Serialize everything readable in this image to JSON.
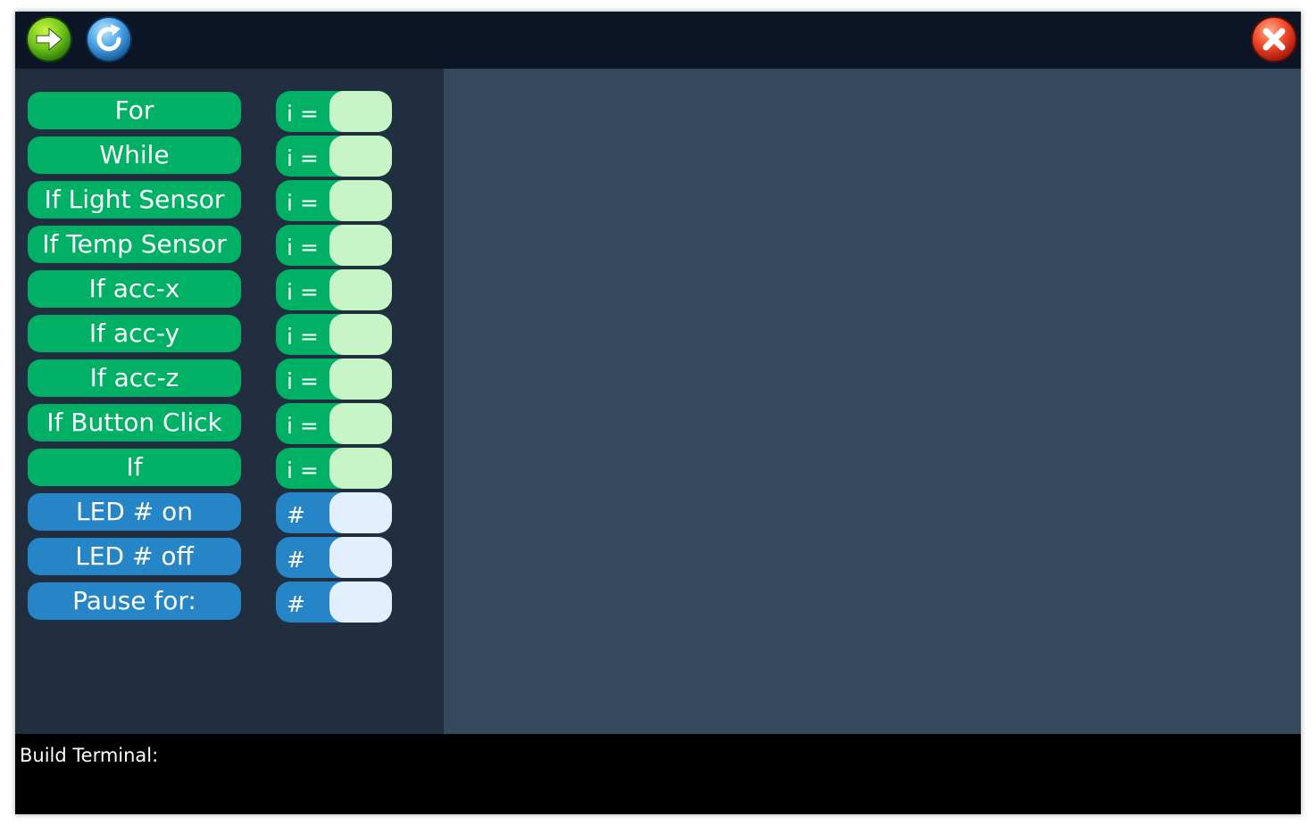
{
  "toolbar": {
    "run_icon": "arrow-right-icon",
    "refresh_icon": "refresh-icon",
    "close_icon": "close-icon"
  },
  "palette": {
    "blocks": [
      {
        "label": "For",
        "color": "green",
        "param_label": "i =",
        "param_value": ""
      },
      {
        "label": "While",
        "color": "green",
        "param_label": "i =",
        "param_value": ""
      },
      {
        "label": "If Light Sensor",
        "color": "green",
        "param_label": "i =",
        "param_value": ""
      },
      {
        "label": "If Temp Sensor",
        "color": "green",
        "param_label": "i =",
        "param_value": ""
      },
      {
        "label": "If acc-x",
        "color": "green",
        "param_label": "i =",
        "param_value": ""
      },
      {
        "label": "If acc-y",
        "color": "green",
        "param_label": "i =",
        "param_value": ""
      },
      {
        "label": "If acc-z",
        "color": "green",
        "param_label": "i =",
        "param_value": ""
      },
      {
        "label": "If Button Click",
        "color": "green",
        "param_label": "i =",
        "param_value": ""
      },
      {
        "label": "If",
        "color": "green",
        "param_label": "i =",
        "param_value": ""
      },
      {
        "label": "LED # on",
        "color": "blue",
        "param_label": "#",
        "param_value": ""
      },
      {
        "label": "LED # off",
        "color": "blue",
        "param_label": "#",
        "param_value": ""
      },
      {
        "label": "Pause for:",
        "color": "blue",
        "param_label": "#",
        "param_value": ""
      }
    ]
  },
  "terminal": {
    "label": "Build Terminal:"
  },
  "colors": {
    "control_block": "#00b064",
    "action_block": "#2585c6",
    "control_input": "#c8f5c8",
    "action_input": "#e1efff",
    "palette_bg": "#212e3f",
    "canvas_bg": "#34485e",
    "topbar_bg": "#0b1526",
    "terminal_bg": "#000000"
  }
}
